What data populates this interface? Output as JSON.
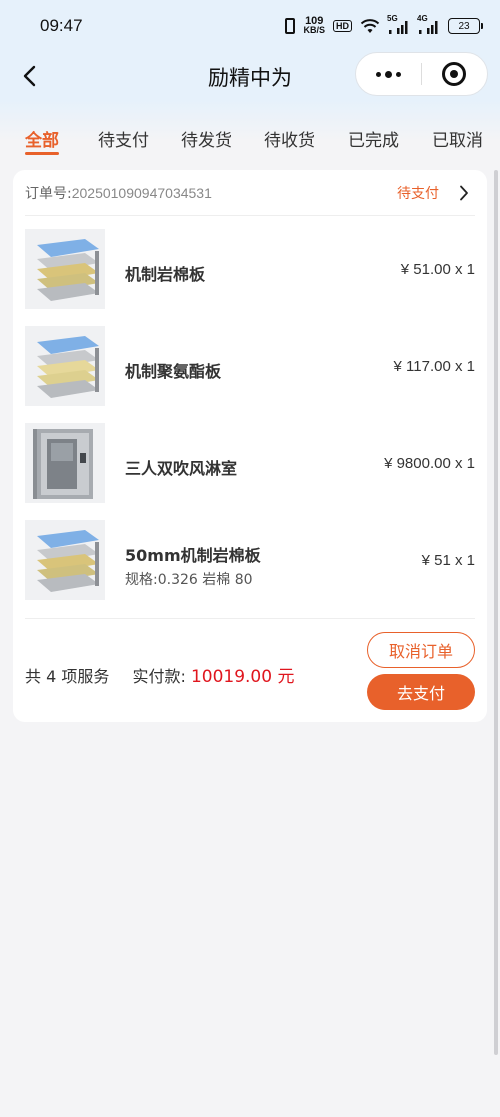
{
  "status_bar": {
    "time": "09:47",
    "net_speed_value": "109",
    "net_speed_unit": "KB/S",
    "hd_badge": "HD",
    "signal_1_gen": "5G",
    "signal_2_gen": "4G",
    "battery": "23"
  },
  "nav": {
    "title": "励精中为"
  },
  "tabs": [
    {
      "label": "全部",
      "active": true
    },
    {
      "label": "待支付"
    },
    {
      "label": "待发货"
    },
    {
      "label": "待收货"
    },
    {
      "label": "已完成"
    },
    {
      "label": "已取消"
    }
  ],
  "order": {
    "no_label": "订单号:",
    "no": "202501090947034531",
    "status": "待支付",
    "items": [
      {
        "name": "机制岩棉板",
        "price": "¥ 51.00 x 1",
        "spec": ""
      },
      {
        "name": "机制聚氨酯板",
        "price": "¥ 117.00 x 1",
        "spec": ""
      },
      {
        "name": "三人双吹风淋室",
        "price": "¥ 9800.00 x 1",
        "spec": ""
      },
      {
        "name": "50mm机制岩棉板",
        "price": "¥ 51 x 1",
        "spec": "规格:0.326 岩棉 80"
      }
    ],
    "count_text": "共 4 项服务",
    "paid_label": "实付款:",
    "total": "10019.00 元",
    "cancel_label": "取消订单",
    "pay_label": "去支付"
  },
  "colors": {
    "accent": "#e8612b",
    "price_red": "#e0161e",
    "header_bg": "#e6f1fb",
    "page_bg": "#f4f4f6"
  }
}
